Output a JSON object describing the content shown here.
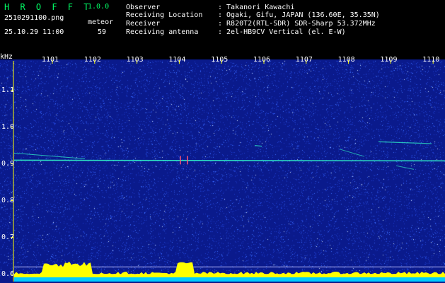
{
  "app": {
    "title": "H R O F F T",
    "version": "1.0.0"
  },
  "file": {
    "name": "2510291100.png",
    "datetime": "25.10.29 11:00"
  },
  "meteor": {
    "label": "meteor",
    "count": "59"
  },
  "info": [
    {
      "label": "Observer",
      "value": ": Takanori Kawachi"
    },
    {
      "label": "Receiving Location",
      "value": ": Ogaki, Gifu, JAPAN (136.60E, 35.35N)"
    },
    {
      "label": "Receiver",
      "value": ": R820T2(RTL-SDR) SDR-Sharp 53.372MHz"
    },
    {
      "label": "Receiving antenna",
      "value": ": 2el-HB9CV Vertical (el. E-W)"
    }
  ],
  "chart_data": {
    "type": "heatmap",
    "ylabel": "kHz",
    "x_ticks": [
      "1101",
      "1102",
      "1103",
      "1104",
      "1105",
      "1106",
      "1107",
      "1108",
      "1109",
      "1110"
    ],
    "y_ticks": [
      "1.1",
      "1.0",
      "0.9",
      "0.8",
      "0.7",
      "0.6"
    ],
    "y_tick_values": [
      1.1,
      1.0,
      0.9,
      0.8,
      0.7,
      0.6
    ],
    "ylim": [
      0.58,
      1.18
    ],
    "carrier_khz": 0.91,
    "colors": {
      "background": "#0a1a8c",
      "noise": "#3a6cff",
      "carrier": "#33ffcc",
      "level": "#ffff00",
      "baseline": "#00ccff"
    }
  }
}
